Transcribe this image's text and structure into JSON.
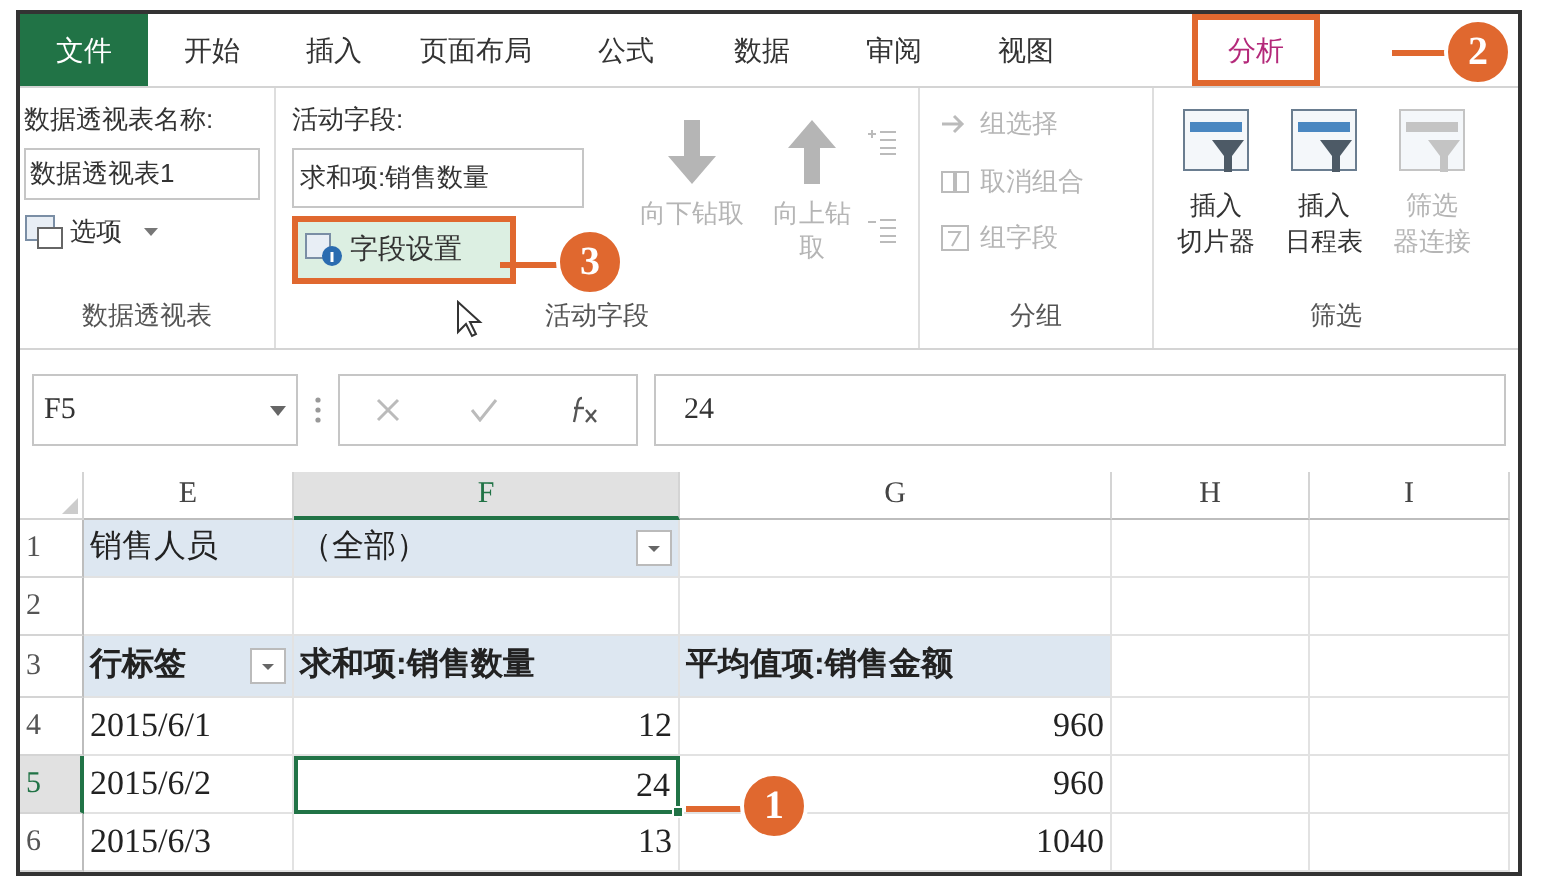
{
  "tabs": [
    {
      "label": "文件",
      "kind": "file",
      "selected": false
    },
    {
      "label": "开始",
      "kind": "tab",
      "selected": false
    },
    {
      "label": "插入",
      "kind": "tab",
      "selected": false
    },
    {
      "label": "页面布局",
      "kind": "tab",
      "selected": false
    },
    {
      "label": "公式",
      "kind": "tab",
      "selected": false
    },
    {
      "label": "数据",
      "kind": "tab",
      "selected": false
    },
    {
      "label": "审阅",
      "kind": "tab",
      "selected": false
    },
    {
      "label": "视图",
      "kind": "tab",
      "selected": false
    },
    {
      "label": "分析",
      "kind": "tab",
      "selected": true
    }
  ],
  "pivot_group": {
    "name_label": "数据透视表名称:",
    "name_value": "数据透视表1",
    "options_button": "选项",
    "label": "数据透视表"
  },
  "field_group": {
    "field_label": "活动字段:",
    "field_value": "求和项:销售数量",
    "settings_button": "字段设置",
    "drill_down": {
      "label": "向下钻取",
      "disabled": true
    },
    "drill_up": {
      "label": "向上钻取",
      "disabled": true
    },
    "label": "活动字段"
  },
  "group_group": {
    "items": [
      {
        "label": "组选择",
        "disabled": true
      },
      {
        "label": "取消组合",
        "disabled": true
      },
      {
        "label": "组字段",
        "disabled": true
      }
    ],
    "label": "分组"
  },
  "filter_group": {
    "items": [
      {
        "lines": [
          "插入",
          "切片器"
        ],
        "disabled": false
      },
      {
        "lines": [
          "插入",
          "日程表"
        ],
        "disabled": false
      },
      {
        "lines": [
          "筛选",
          "器连接"
        ],
        "disabled": true
      }
    ],
    "label": "筛选"
  },
  "formula_bar": {
    "name_box": "F5",
    "value": "24"
  },
  "sheet": {
    "columns": [
      {
        "label": "E",
        "selected": false
      },
      {
        "label": "F",
        "selected": true
      },
      {
        "label": "G",
        "selected": false
      },
      {
        "label": "H",
        "selected": false
      },
      {
        "label": "I",
        "selected": false
      }
    ],
    "rows": [
      {
        "header": "1",
        "kind": "filter",
        "selected": false,
        "cells": [
          {
            "text": "销售人员",
            "kind": "text"
          },
          {
            "text": "（全部）",
            "kind": "text",
            "dropdown": true
          },
          {},
          {},
          {}
        ]
      },
      {
        "header": "2",
        "kind": "blank",
        "selected": false,
        "cells": [
          {},
          {},
          {},
          {},
          {}
        ]
      },
      {
        "header": "3",
        "kind": "pivot_header",
        "selected": false,
        "cells": [
          {
            "text": "行标签",
            "kind": "text",
            "dropdown": true
          },
          {
            "text": "求和项:销售数量",
            "kind": "text"
          },
          {
            "text": "平均值项:销售金额",
            "kind": "text"
          },
          {},
          {}
        ]
      },
      {
        "header": "4",
        "kind": "data",
        "selected": false,
        "cells": [
          {
            "text": "2015/6/1",
            "kind": "text"
          },
          {
            "text": "12",
            "kind": "number"
          },
          {
            "text": "960",
            "kind": "number"
          },
          {},
          {}
        ]
      },
      {
        "header": "5",
        "kind": "data",
        "selected": true,
        "cells": [
          {
            "text": "2015/6/2",
            "kind": "text"
          },
          {
            "text": "24",
            "kind": "number",
            "selected": true
          },
          {
            "text": "960",
            "kind": "number"
          },
          {},
          {}
        ]
      },
      {
        "header": "6",
        "kind": "data",
        "selected": false,
        "cells": [
          {
            "text": "2015/6/3",
            "kind": "text"
          },
          {
            "text": "13",
            "kind": "number"
          },
          {
            "text": "1040",
            "kind": "number"
          },
          {},
          {}
        ]
      }
    ]
  },
  "callouts": [
    {
      "text": "2"
    },
    {
      "text": "3"
    },
    {
      "text": "1"
    }
  ]
}
